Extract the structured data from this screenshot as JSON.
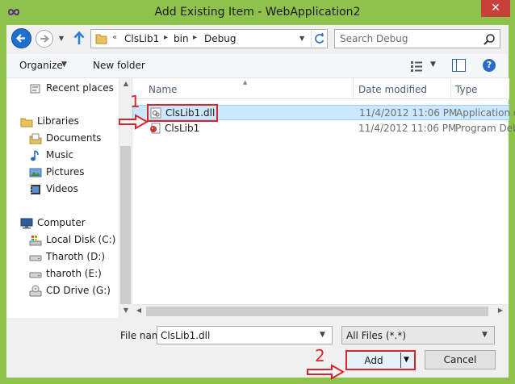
{
  "window": {
    "title": "Add Existing Item - WebApplication2",
    "close_glyph": "✕",
    "accent_color": "#8dc24c"
  },
  "navigation": {
    "path": [
      "ClsLib1",
      "bin",
      "Debug"
    ],
    "overflow_glyph": "«",
    "search_placeholder": "Search Debug"
  },
  "toolbar": {
    "organize_label": "Organize",
    "new_folder_label": "New folder",
    "help_glyph": "?"
  },
  "nav_pane": {
    "items": [
      {
        "label": "Recent places",
        "icon": "recent-places-icon"
      },
      {
        "label": "Libraries",
        "icon": "libraries-icon"
      },
      {
        "label": "Documents",
        "icon": "documents-icon"
      },
      {
        "label": "Music",
        "icon": "music-icon"
      },
      {
        "label": "Pictures",
        "icon": "pictures-icon"
      },
      {
        "label": "Videos",
        "icon": "videos-icon"
      },
      {
        "label": "Computer",
        "icon": "computer-icon"
      },
      {
        "label": "Local Disk (C:)",
        "icon": "local-disk-icon"
      },
      {
        "label": "Tharoth (D:)",
        "icon": "drive-icon"
      },
      {
        "label": "tharoth (E:)",
        "icon": "drive-icon"
      },
      {
        "label": "CD Drive (G:)",
        "icon": "cd-drive-icon"
      }
    ]
  },
  "file_list": {
    "columns": {
      "name": "Name",
      "date": "Date modified",
      "type": "Type"
    },
    "rows": [
      {
        "name": "ClsLib1.dll",
        "date": "11/4/2012 11:06 PM",
        "type": "Application e",
        "icon": "dll-file-icon",
        "selected": true
      },
      {
        "name": "ClsLib1",
        "date": "11/4/2012 11:06 PM",
        "type": "Program Deb",
        "icon": "pdb-file-icon",
        "selected": false
      }
    ]
  },
  "footer": {
    "file_name_label": "File name:",
    "file_name_value": "ClsLib1.dll",
    "filter_value": "All Files (*.*)",
    "add_label": "Add",
    "cancel_label": "Cancel"
  },
  "annotations": {
    "step1": "1",
    "step2": "2",
    "color": "#d9252a"
  }
}
